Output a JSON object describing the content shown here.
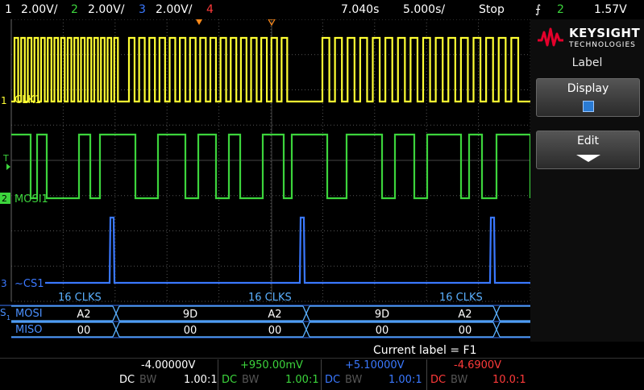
{
  "topbar": {
    "ch1_num": "1",
    "ch1_scale": "2.00V/",
    "ch2_num": "2",
    "ch2_scale": "2.00V/",
    "ch3_num": "3",
    "ch3_scale": "2.00V/",
    "ch4_num": "4",
    "time_delay": "7.040s",
    "time_scale": "5.000s/",
    "run_state": "Stop",
    "trig_source": "2",
    "trig_level": "1.57V"
  },
  "colors": {
    "ch1": "#ffff33",
    "ch2": "#3cd43c",
    "ch3": "#3a78ff",
    "ch4": "#ff3a3a",
    "serial": "#4a90ff",
    "bus": "#5ab0ff"
  },
  "labels": {
    "clk": "CLK1",
    "mosi": "MOSI1",
    "cs": "~CS1",
    "serial_mosi": "MOSI",
    "serial_miso": "MISO",
    "serial_id": "S1"
  },
  "annotations": [
    "16 CLKS",
    "16 CLKS",
    "16 CLKS"
  ],
  "decode": {
    "mosi": [
      "A2",
      "9D",
      "A2",
      "9D",
      "A2"
    ],
    "miso": [
      "00",
      "00",
      "00",
      "00",
      "00"
    ]
  },
  "panel": {
    "brand": "KEYSIGHT",
    "brand_sub": "TECHNOLOGIES",
    "title": "Label",
    "display_label": "Display",
    "edit_label": "Edit"
  },
  "status": {
    "current_label": "Current label = F1",
    "channels": [
      {
        "offset": "-4.00000V",
        "coupling": "DC",
        "bw": "BW",
        "ratio": "1.00:1"
      },
      {
        "offset": "+950.00mV",
        "coupling": "DC",
        "bw": "BW",
        "ratio": "1.00:1"
      },
      {
        "offset": "+5.10000V",
        "coupling": "DC",
        "bw": "BW",
        "ratio": "1.00:1"
      },
      {
        "offset": "-4.6900V",
        "coupling": "DC",
        "bw": "BW",
        "ratio": "10.0:1"
      }
    ]
  }
}
